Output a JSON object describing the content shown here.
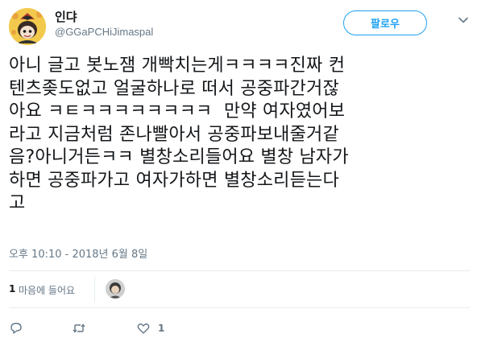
{
  "author": {
    "display_name": "인댜",
    "handle": "@GGaPCHiJimaspal"
  },
  "follow_button": {
    "label": "팔로우"
  },
  "tweet": {
    "lines": [
      "아니 글고 봇노잼 개빡치는게ㅋㅋㅋㅋ진짜 컨",
      "텐츠좆도없고 얼굴하나로 떠서 공중파간거잖",
      "아요 ㅋㅌㅋㅋㅋㅋㅋㅋㅋㅋ  만약 여자였어보",
      "라고 지금처럼 존나빨아서 공중파보내줄거같",
      "음?아니거든ㅋㅋ 별창소리들어요 별창 남자가",
      "하면 공중파가고 여자가하면 별창소리듣는다",
      "고"
    ],
    "timestamp": "오후 10:10 - 2018년 6월 8일"
  },
  "likes": {
    "count": "1",
    "label": "마음에 들어요"
  },
  "actions": {
    "reply_count": "",
    "retweet_count": "",
    "like_count": "1"
  },
  "colors": {
    "accent": "#1da1f2",
    "muted": "#657786",
    "text": "#14171a",
    "divider": "#e6ecf0"
  }
}
